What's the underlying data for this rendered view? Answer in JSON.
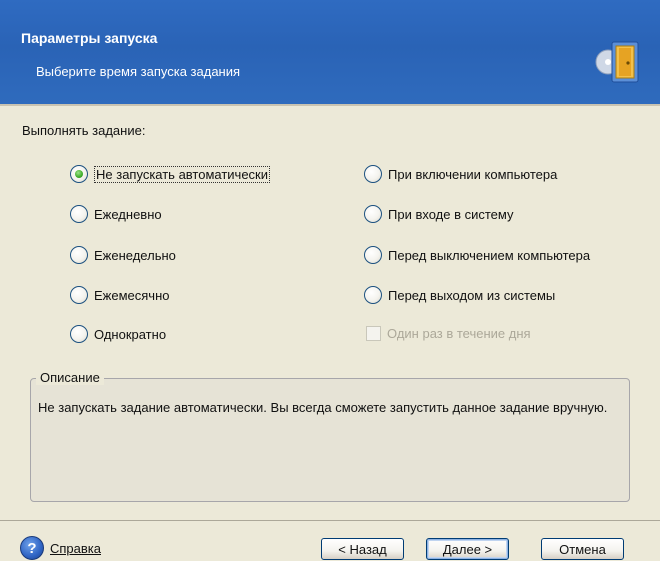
{
  "header": {
    "title": "Параметры запуска",
    "subtitle": "Выберите время запуска задания",
    "icon": "wizard-exit-icon",
    "accent_color": "#2a63b6"
  },
  "run_label": "Выполнять задание:",
  "options_left": [
    {
      "label": "Не запускать автоматически",
      "selected": true
    },
    {
      "label": "Ежедневно",
      "selected": false
    },
    {
      "label": "Еженедельно",
      "selected": false
    },
    {
      "label": "Ежемесячно",
      "selected": false
    },
    {
      "label": "Однократно",
      "selected": false
    }
  ],
  "options_right": [
    {
      "label": "При включении компьютера",
      "selected": false
    },
    {
      "label": "При входе в систему",
      "selected": false
    },
    {
      "label": "Перед выключением компьютера",
      "selected": false
    },
    {
      "label": "Перед выходом из системы",
      "selected": false
    }
  ],
  "once_per_day": {
    "label": "Один раз в течение дня",
    "checked": false,
    "disabled": true
  },
  "description": {
    "legend": "Описание",
    "text": "Не запускать задание автоматически. Вы всегда сможете запустить данное задание вручную."
  },
  "footer": {
    "help": "Справка",
    "back": "< Назад",
    "next": "Далее >",
    "cancel": "Отмена"
  }
}
